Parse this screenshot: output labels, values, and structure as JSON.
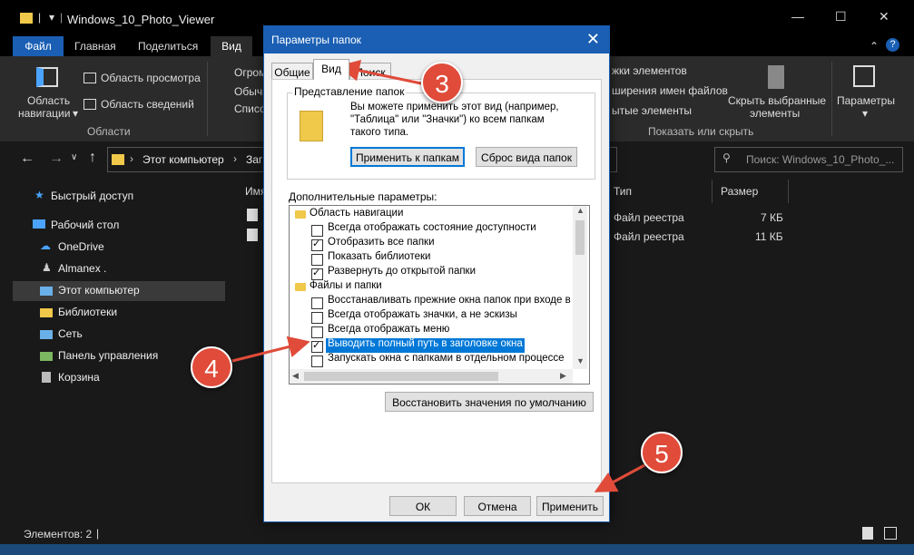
{
  "window": {
    "title": "Windows_10_Photo_Viewer",
    "minimize_icon": "minimize-icon",
    "maximize_icon": "maximize-icon",
    "close_icon": "close-icon"
  },
  "ribbon_tabs": [
    "Файл",
    "Главная",
    "Поделиться",
    "Вид"
  ],
  "ribbon": {
    "nav_pane_label_1": "Область",
    "nav_pane_label_2": "навигации",
    "preview_pane": "Область просмотра",
    "details_pane": "Область сведений",
    "group_panes": "Области",
    "layout_1": "Огром",
    "layout_2": "Обычн",
    "layout_3": "Списо",
    "show_1": "жки элементов",
    "show_2": "ширения имен файлов",
    "show_3": "ытые элементы",
    "hide_selected_1": "Скрыть выбранные",
    "hide_selected_2": "элементы",
    "group_show_hide": "Показать или скрыть",
    "options": "Параметры"
  },
  "address": {
    "crumb_1": "Этот компьютер",
    "crumb_2": "Загр",
    "search_placeholder": "Поиск: Windows_10_Photo_..."
  },
  "nav": [
    {
      "label": "Быстрый доступ",
      "icon": "star-icon"
    },
    {
      "label": "Рабочий стол",
      "icon": "desktop-icon"
    },
    {
      "label": "OneDrive",
      "icon": "cloud-icon"
    },
    {
      "label": "Almanex .",
      "icon": "user-icon"
    },
    {
      "label": "Этот компьютер",
      "icon": "computer-icon"
    },
    {
      "label": "Библиотеки",
      "icon": "library-icon"
    },
    {
      "label": "Сеть",
      "icon": "network-icon"
    },
    {
      "label": "Панель управления",
      "icon": "control-panel-icon"
    },
    {
      "label": "Корзина",
      "icon": "recycle-bin-icon"
    }
  ],
  "files": {
    "col_name": "Имя",
    "col_type": "Тип",
    "col_size": "Размер",
    "rows": [
      {
        "type": "Файл реестра",
        "size": "7 КБ"
      },
      {
        "type": "Файл реестра",
        "size": "11 КБ"
      }
    ]
  },
  "status": {
    "items": "Элементов: 2"
  },
  "dialog": {
    "title": "Параметры папок",
    "tabs": [
      "Общие",
      "Вид",
      "Поиск"
    ],
    "folder_views_title": "Представление папок",
    "folder_views_text_1": "Вы можете применить этот вид (например,",
    "folder_views_text_2": "\"Таблица\" или \"Значки\") ко всем папкам",
    "folder_views_text_3": "такого типа.",
    "apply_to_folders": "Применить к папкам",
    "reset_folders": "Сброс вида папок",
    "advanced_title": "Дополнительные параметры:",
    "tree": [
      {
        "kind": "folder",
        "label": "Область навигации"
      },
      {
        "kind": "check",
        "checked": false,
        "label": "Всегда отображать состояние доступности"
      },
      {
        "kind": "check",
        "checked": true,
        "label": "Отобразить все папки"
      },
      {
        "kind": "check",
        "checked": false,
        "label": "Показать библиотеки"
      },
      {
        "kind": "check",
        "checked": true,
        "label": "Развернуть до открытой папки"
      },
      {
        "kind": "folder",
        "label": "Файлы и папки"
      },
      {
        "kind": "check",
        "checked": false,
        "label": "Восстанавливать прежние окна папок при входе в си"
      },
      {
        "kind": "check",
        "checked": false,
        "label": "Всегда отображать значки, а не эскизы"
      },
      {
        "kind": "check",
        "checked": false,
        "label": "Всегда отображать меню"
      },
      {
        "kind": "check",
        "checked": true,
        "label": "Выводить полный путь в заголовке окна",
        "selected": true
      },
      {
        "kind": "check",
        "checked": false,
        "label": "Запускать окна с папками в отдельном процессе"
      }
    ],
    "restore_defaults": "Восстановить значения по умолчанию",
    "ok": "ОК",
    "cancel": "Отмена",
    "apply": "Применить"
  },
  "markers": [
    "3",
    "4",
    "5"
  ],
  "colors": {
    "accent": "#1a5fb4",
    "marker": "#e04b3a",
    "selection": "#0078d7"
  }
}
